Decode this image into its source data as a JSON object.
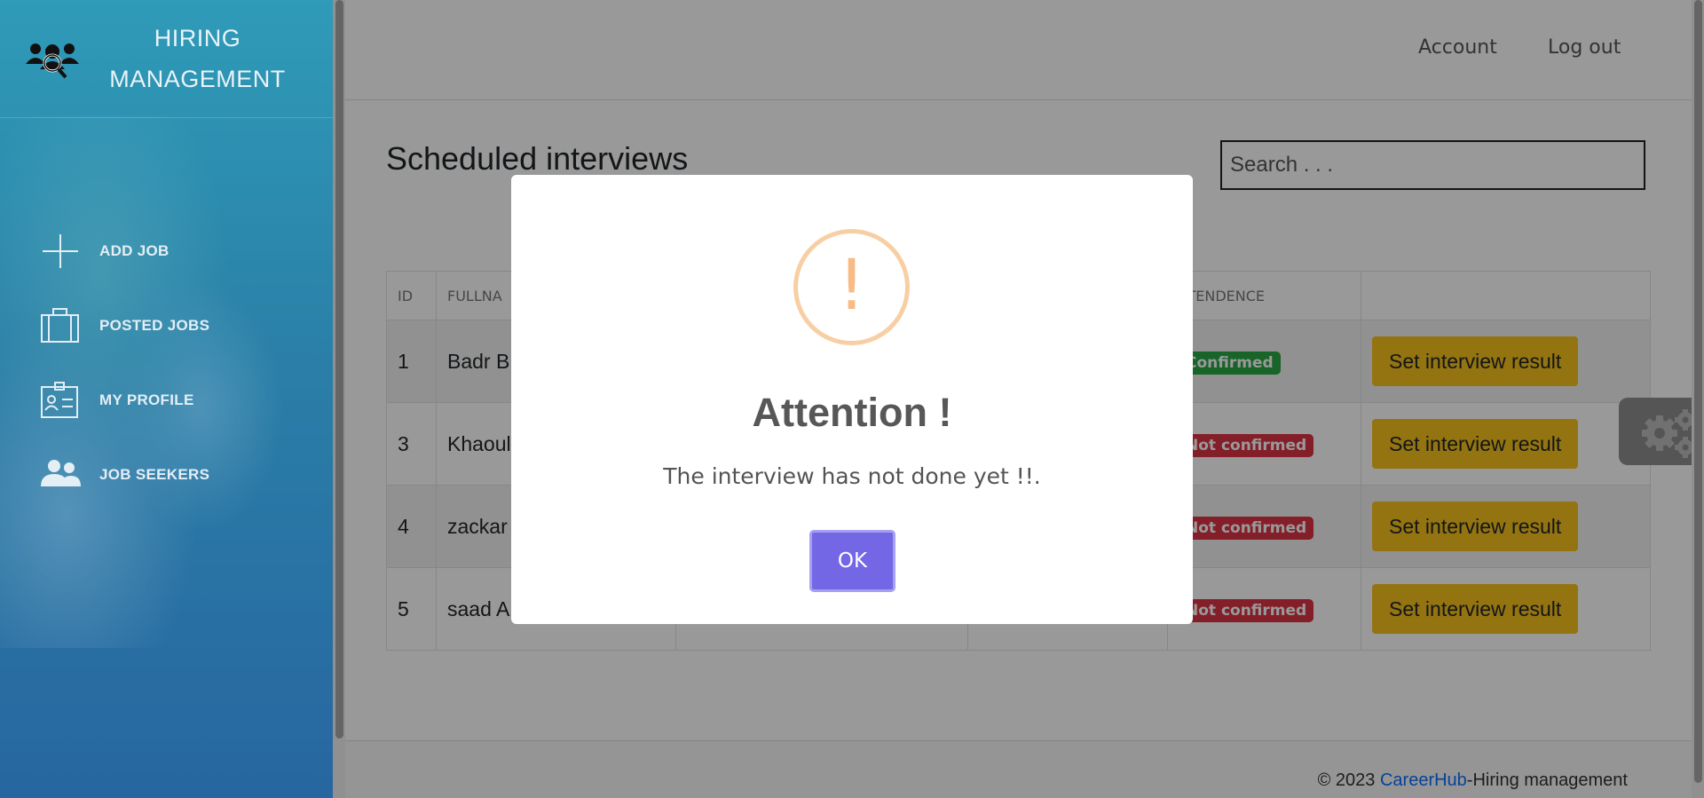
{
  "sidebar": {
    "brand_line1": "HIRING",
    "brand_line2": "MANAGEMENT",
    "logo_icon": "people-search-icon",
    "items": [
      {
        "label": "ADD JOB",
        "icon": "plus-icon"
      },
      {
        "label": "POSTED JOBS",
        "icon": "briefcase-icon"
      },
      {
        "label": "MY PROFILE",
        "icon": "id-card-icon"
      },
      {
        "label": "JOB SEEKERS",
        "icon": "users-icon"
      }
    ]
  },
  "header": {
    "account_label": "Account",
    "logout_label": "Log out"
  },
  "main": {
    "title": "Scheduled interviews",
    "search_placeholder": "Search . . .",
    "columns": [
      "ID",
      "FULLNA",
      "",
      "",
      "TTENDENCE",
      ""
    ],
    "rows": [
      {
        "id": "1",
        "name": "Badr B",
        "status": "Confirmed",
        "status_color": "#28a745",
        "action": "Set interview result"
      },
      {
        "id": "3",
        "name": "Khaoul",
        "status": "Not confirmed",
        "status_color": "#dc3545",
        "action": "Set interview result"
      },
      {
        "id": "4",
        "name": "zackar",
        "status": "Not confirmed",
        "status_color": "#dc3545",
        "action": "Set interview result"
      },
      {
        "id": "5",
        "name": "saad A",
        "status": "Not confirmed",
        "status_color": "#dc3545",
        "action": "Set interview result"
      }
    ]
  },
  "footer": {
    "prefix": "© 2023 ",
    "link": "CareerHub",
    "suffix": "-Hiring management"
  },
  "modal": {
    "icon": "exclamation-icon",
    "symbol": "!",
    "title": "Attention !",
    "message": "The interview has not done yet !!.",
    "ok_label": "OK"
  },
  "settings_icon": "gear-icon",
  "colors": {
    "accent": "#7367e6",
    "warning_button": "#f7c21b",
    "sidebar": "#2a7fa8"
  }
}
